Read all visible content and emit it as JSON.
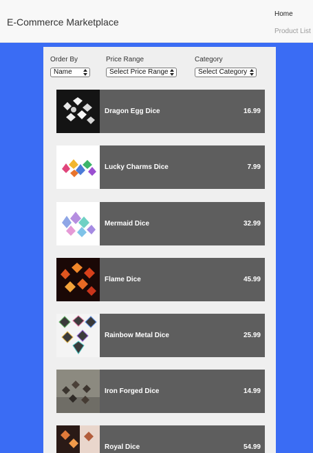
{
  "header": {
    "brand": "E-Commerce Marketplace",
    "nav": [
      {
        "label": "Home"
      },
      {
        "label": "Product List"
      }
    ]
  },
  "filters": {
    "order_by": {
      "label": "Order By",
      "selected": "Name"
    },
    "price_range": {
      "label": "Price Range",
      "selected": "Select Price Range"
    },
    "category": {
      "label": "Category",
      "selected": "Select Category"
    }
  },
  "products": [
    {
      "name": "Dragon Egg Dice",
      "price": "16.99"
    },
    {
      "name": "Lucky Charms Dice",
      "price": "7.99"
    },
    {
      "name": "Mermaid Dice",
      "price": "32.99"
    },
    {
      "name": "Flame Dice",
      "price": "45.99"
    },
    {
      "name": "Rainbow Metal Dice",
      "price": "25.99"
    },
    {
      "name": "Iron Forged Dice",
      "price": "14.99"
    },
    {
      "name": "Royal Dice",
      "price": "54.99"
    }
  ],
  "colors": {
    "page_background": "#3a6cf4",
    "panel_background": "#efefef",
    "card_background": "#5e5e5e",
    "header_background": "#f8f8f8"
  },
  "icons": [
    "select-arrows-icon"
  ]
}
